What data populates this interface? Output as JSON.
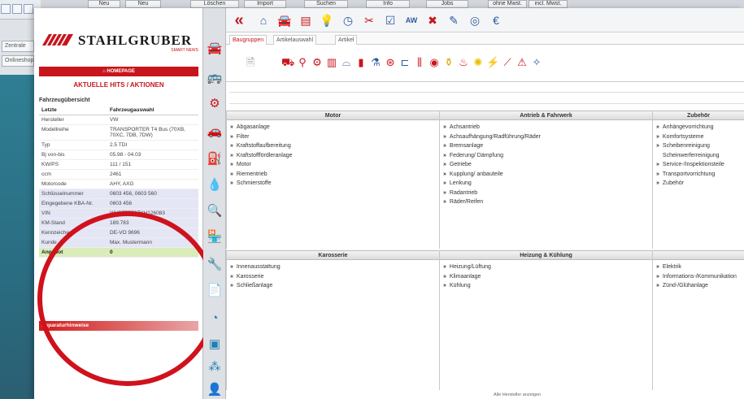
{
  "background": {
    "toolbar_buttons": [
      "Neu",
      "Neu",
      "Löschen",
      "Import",
      "Suchen",
      "Info",
      "Jobs",
      "ohne Mwst.",
      "incl. Mwst."
    ],
    "left_rows": [
      "Zentrale",
      "Onlineshop"
    ]
  },
  "brand": {
    "name": "STAHLGRUBER",
    "tagline": "SMART NEWS",
    "homepage": "HOMEPAGE",
    "news_title": "AKTUELLE HITS / AKTIONEN",
    "accent_color": "#c8151b"
  },
  "vehicle": {
    "section_title": "Fahrzeugübersicht",
    "col_last": "Letzte",
    "col_selection": "Fahrzeugauswahl",
    "rows": [
      {
        "label": "Hersteller",
        "value": "VW"
      },
      {
        "label": "Modellreihe",
        "value": "TRANSPORTER T4 Bus (70XB, 70XC, 7DB, 7DW)"
      },
      {
        "label": "Typ",
        "value": "2.5 TDI"
      },
      {
        "label": "Bj von-bis",
        "value": "05.98 - 04.03"
      },
      {
        "label": "KW/PS",
        "value": "111 / 151"
      },
      {
        "label": "ccm",
        "value": "2461"
      },
      {
        "label": "Motorcode",
        "value": "AHY, AXG"
      },
      {
        "label": "Schlüsselnummer",
        "value": "0603 456, 0603 560"
      },
      {
        "label": "Eingegebene KBA-Nr.",
        "value": "0603 456"
      },
      {
        "label": "VIN",
        "value": "WV2ZZZ70ZYH126083"
      },
      {
        "label": "KM-Stand",
        "value": "189.783"
      },
      {
        "label": "Kennzeichen",
        "value": "DE-VO 9696"
      },
      {
        "label": "Kunde",
        "value": "Max. Mustermann"
      },
      {
        "label": "Angebot",
        "value": "0"
      }
    ],
    "repair_bar": "Reparaturhinweise"
  },
  "tabs": [
    "Baugruppen",
    "Artikelauswahl",
    "Artikel"
  ],
  "groups": {
    "top": [
      {
        "title": "Motor",
        "items": [
          "Abgasanlage",
          "Filter",
          "Kraftstoffaufbereitung",
          "Kraftstofffördleranlage",
          "Motor",
          "Riementrieb",
          "Schmierstoffe"
        ]
      },
      {
        "title": "Antrieb & Fahrwerk",
        "items": [
          "Achsantrieb",
          "Achsaufhängung/Radführung/Räder",
          "Bremsanlage",
          "Federung/ Dämpfung",
          "Getriebe",
          "Kupplung/ anbauteile",
          "Lenkung",
          "Radantrieb",
          "Räder/Reifen"
        ]
      },
      {
        "title": "Zubehör",
        "items": [
          "Anhängevorrichtung",
          "Komfortsysteme",
          "Scheibenreinigung",
          "Scheinwerferreinigung",
          "Service-/Inspektionsteile",
          "Transportvorrichtung",
          "Zubehör"
        ]
      }
    ],
    "bottom": [
      {
        "title": "Karosserie",
        "items": [
          "Innenausstattung",
          "Karosserie",
          "Schließanlage"
        ]
      },
      {
        "title": "Heizung & Kühlung",
        "items": [
          "Heizung/Lüftung",
          "Klimaanlage",
          "Kühlung"
        ]
      },
      {
        "title": "",
        "items": [
          "Elektrik",
          "Informations-/Kommunikation",
          "Zünd-/Glühanlage"
        ]
      }
    ]
  },
  "footer_link": "Alle Hersteller anzeigen"
}
